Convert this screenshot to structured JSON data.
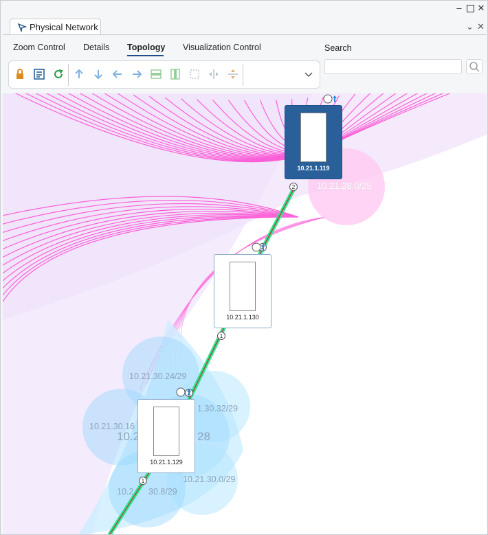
{
  "window": {
    "tab_title": "Physical Network"
  },
  "menu": {
    "items": [
      "Zoom Control",
      "Details",
      "Topology",
      "Visualization Control"
    ],
    "active": "Topology"
  },
  "search": {
    "label": "Search",
    "value": "",
    "placeholder": ""
  },
  "devices": [
    {
      "ip": "10.21.1.119",
      "selected": true
    },
    {
      "ip": "10.21.1.130",
      "selected": false
    },
    {
      "ip": "10.21.1.129",
      "selected": false
    }
  ],
  "subnets": [
    {
      "label": "10.21.28.0/25"
    },
    {
      "label": "10.21.30.24/29"
    },
    {
      "label": "1.30.32/29"
    },
    {
      "label": "10.21.30.16"
    },
    {
      "label": "10.2"
    },
    {
      "label": "28"
    },
    {
      "label": "10.21.30.0/29"
    },
    {
      "label": "10.2"
    },
    {
      "label": "30.8/29"
    }
  ],
  "ports": [
    "2",
    "2",
    "1",
    "2",
    "1"
  ],
  "colors": {
    "selected_device": "#2a6099",
    "accent": "#1f4e8c",
    "magenta_link": "#ff33cc",
    "subnet_pink": "#ffccf2",
    "subnet_blue": "#99d6ff",
    "green_link": "#33e699"
  }
}
